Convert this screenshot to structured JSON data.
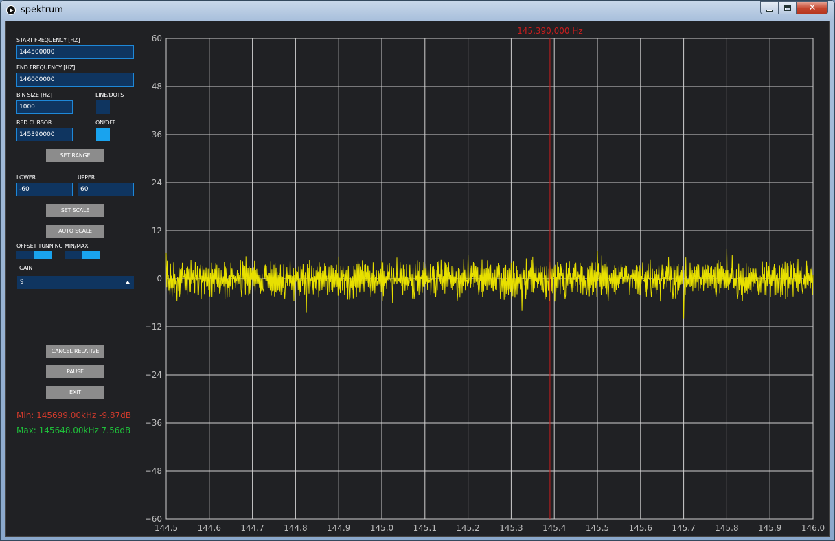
{
  "window": {
    "title": "spektrum",
    "close_glyph": "✕"
  },
  "controls": {
    "start_freq_label": "START FREQUENCY [HZ]",
    "start_freq_value": "144500000",
    "end_freq_label": "END FREQUENCY [HZ]",
    "end_freq_value": "146000000",
    "bin_size_label": "BIN SIZE [HZ]",
    "bin_size_value": "1000",
    "line_dots_label": "LINE/DOTS",
    "line_dots_on": false,
    "red_cursor_label": "RED CURSOR",
    "red_cursor_value": "145390000",
    "on_off_label": "ON/OFF",
    "on_off_on": true,
    "set_range": "SET RANGE",
    "lower_label": "LOWER",
    "lower_value": "-60",
    "upper_label": "UPPER",
    "upper_value": "60",
    "set_scale": "SET SCALE",
    "auto_scale": "AUTO SCALE",
    "offset_tuning_label": "OFFSET TUNNING",
    "min_max_label": "MIN/MAX",
    "offset_tuning_on": true,
    "min_max_on": true,
    "gain_label": "GAIN",
    "gain_value": "9",
    "cancel_relative": "CANCEL RELATIVE",
    "pause": "PAUSE",
    "exit": "EXIT"
  },
  "stats": {
    "min": "Min: 145699.00kHz -9.87dB",
    "max": "Max: 145648.00kHz 7.56dB"
  },
  "colors": {
    "trace": "#e8e000",
    "cursor": "#c81e1e",
    "min_text": "#d03a2c",
    "max_text": "#1fbf3a",
    "input_bg": "#0f3560",
    "accent": "#19a3ee"
  },
  "chart_data": {
    "type": "line",
    "title": "",
    "xlabel": "",
    "ylabel": "",
    "cursor_label": "145,390,000 Hz",
    "cursor_x": 145.39,
    "xlim": [
      144.5,
      146.0
    ],
    "ylim": [
      -60,
      60
    ],
    "x_ticks": [
      "144.5",
      "144.6",
      "144.7",
      "144.8",
      "144.9",
      "145.0",
      "145.1",
      "145.2",
      "145.3",
      "145.4",
      "145.5",
      "145.6",
      "145.7",
      "145.8",
      "145.9",
      "146.0"
    ],
    "y_ticks": [
      "60",
      "48",
      "36",
      "24",
      "12",
      "0",
      "-12",
      "-24",
      "-36",
      "-48",
      "-60"
    ],
    "grid": true,
    "series": [
      {
        "x": [
          144.5,
          144.525,
          144.55,
          144.575,
          144.6,
          144.625,
          144.65,
          144.675,
          144.7,
          144.725,
          144.75,
          144.775,
          144.8,
          144.825,
          144.85,
          144.875,
          144.9,
          144.925,
          144.95,
          144.975,
          145.0,
          145.025,
          145.05,
          145.075,
          145.1,
          145.125,
          145.15,
          145.175,
          145.2,
          145.225,
          145.25,
          145.275,
          145.3,
          145.325,
          145.35,
          145.375,
          145.4,
          145.425,
          145.45,
          145.475,
          145.5,
          145.525,
          145.55,
          145.575,
          145.6,
          145.625,
          145.65,
          145.675,
          145.7,
          145.725,
          145.75,
          145.775,
          145.8,
          145.825,
          145.85,
          145.875,
          145.9,
          145.925,
          145.95,
          145.975,
          146.0
        ],
        "values": [
          6.5,
          -5.5,
          3.0,
          -4.0,
          2.5,
          -3.5,
          4.0,
          -4.5,
          2.0,
          -3.0,
          3.5,
          -5.0,
          2.5,
          -8.5,
          3.0,
          -4.0,
          5.5,
          -5.0,
          3.0,
          -4.5,
          4.5,
          -6.0,
          3.5,
          -5.0,
          2.5,
          -4.5,
          3.5,
          -5.5,
          6.0,
          -4.0,
          3.0,
          -5.0,
          4.0,
          -8.0,
          5.5,
          -3.5,
          3.0,
          -5.0,
          4.0,
          -4.0,
          7.0,
          -5.5,
          3.0,
          -4.0,
          2.5,
          -4.5,
          3.5,
          -5.0,
          -9.87,
          3.0,
          3.5,
          -4.5,
          7.56,
          -5.0,
          3.0,
          -4.0,
          4.0,
          -4.5,
          3.5,
          -3.0,
          1.0
        ]
      }
    ]
  }
}
